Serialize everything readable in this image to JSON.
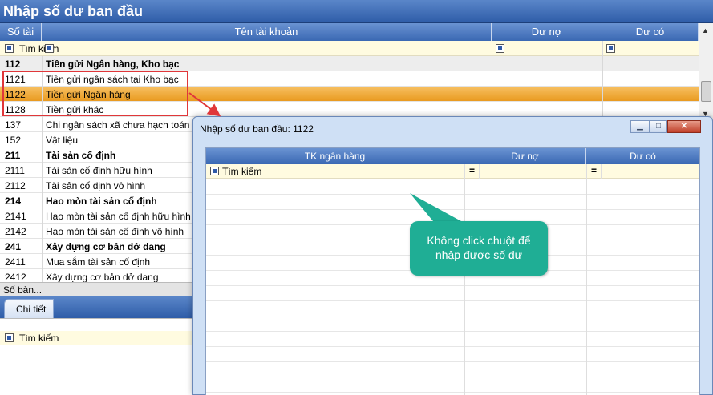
{
  "window": {
    "title": "Nhập số dư ban đầu"
  },
  "grid": {
    "columns": [
      "Số tài",
      "Tên tài khoản",
      "Dư nợ",
      "Dư có"
    ],
    "search_label": "Tìm kiếm",
    "rows": [
      {
        "code": "112",
        "name": "Tiền gửi Ngân hàng, Kho bạc",
        "bold": true
      },
      {
        "code": "1121",
        "name": "Tiền gửi ngân sách tại Kho bạc",
        "bold": false
      },
      {
        "code": "1122",
        "name": "Tiền gửi Ngân hàng",
        "bold": false,
        "selected": true
      },
      {
        "code": "1128",
        "name": "Tiền gửi khác",
        "bold": false
      },
      {
        "code": "137",
        "name": "Chi ngân sách xã chưa hạch toán vào",
        "bold": false
      },
      {
        "code": "152",
        "name": "Vật liệu",
        "bold": false
      },
      {
        "code": "211",
        "name": "Tài sản cố định",
        "bold": true
      },
      {
        "code": "2111",
        "name": "Tài sản cố định hữu hình",
        "bold": false
      },
      {
        "code": "2112",
        "name": "Tài sản cố định vô hình",
        "bold": false
      },
      {
        "code": "214",
        "name": "Hao mòn tài sản cố định",
        "bold": true
      },
      {
        "code": "2141",
        "name": "Hao mòn tài sản cố định hữu hình",
        "bold": false
      },
      {
        "code": "2142",
        "name": "Hao mòn tài sản cố định vô hình",
        "bold": false
      },
      {
        "code": "241",
        "name": "Xây dựng cơ bản dở dang",
        "bold": true
      },
      {
        "code": "2411",
        "name": "Mua sắm tài sản cố định",
        "bold": false
      },
      {
        "code": "2412",
        "name": "Xây dựng cơ bản dở dang",
        "bold": false
      }
    ],
    "footer_label": "Số bản..."
  },
  "detail": {
    "tab_label": "Chi tiết",
    "search_label": "Tìm kiếm"
  },
  "dialog": {
    "title": "Nhập số dư ban đầu: 1122",
    "columns": [
      "TK ngân hàng",
      "Dư nợ",
      "Dư có"
    ],
    "search_label": "Tìm kiếm",
    "filter_symbol": "="
  },
  "callout": {
    "text": "Không click chuột để nhập được số dư"
  },
  "colors": {
    "accent": "#3a68b3",
    "selected": "#e99a20",
    "highlight_box": "#e0373a",
    "callout": "#1fae95"
  }
}
